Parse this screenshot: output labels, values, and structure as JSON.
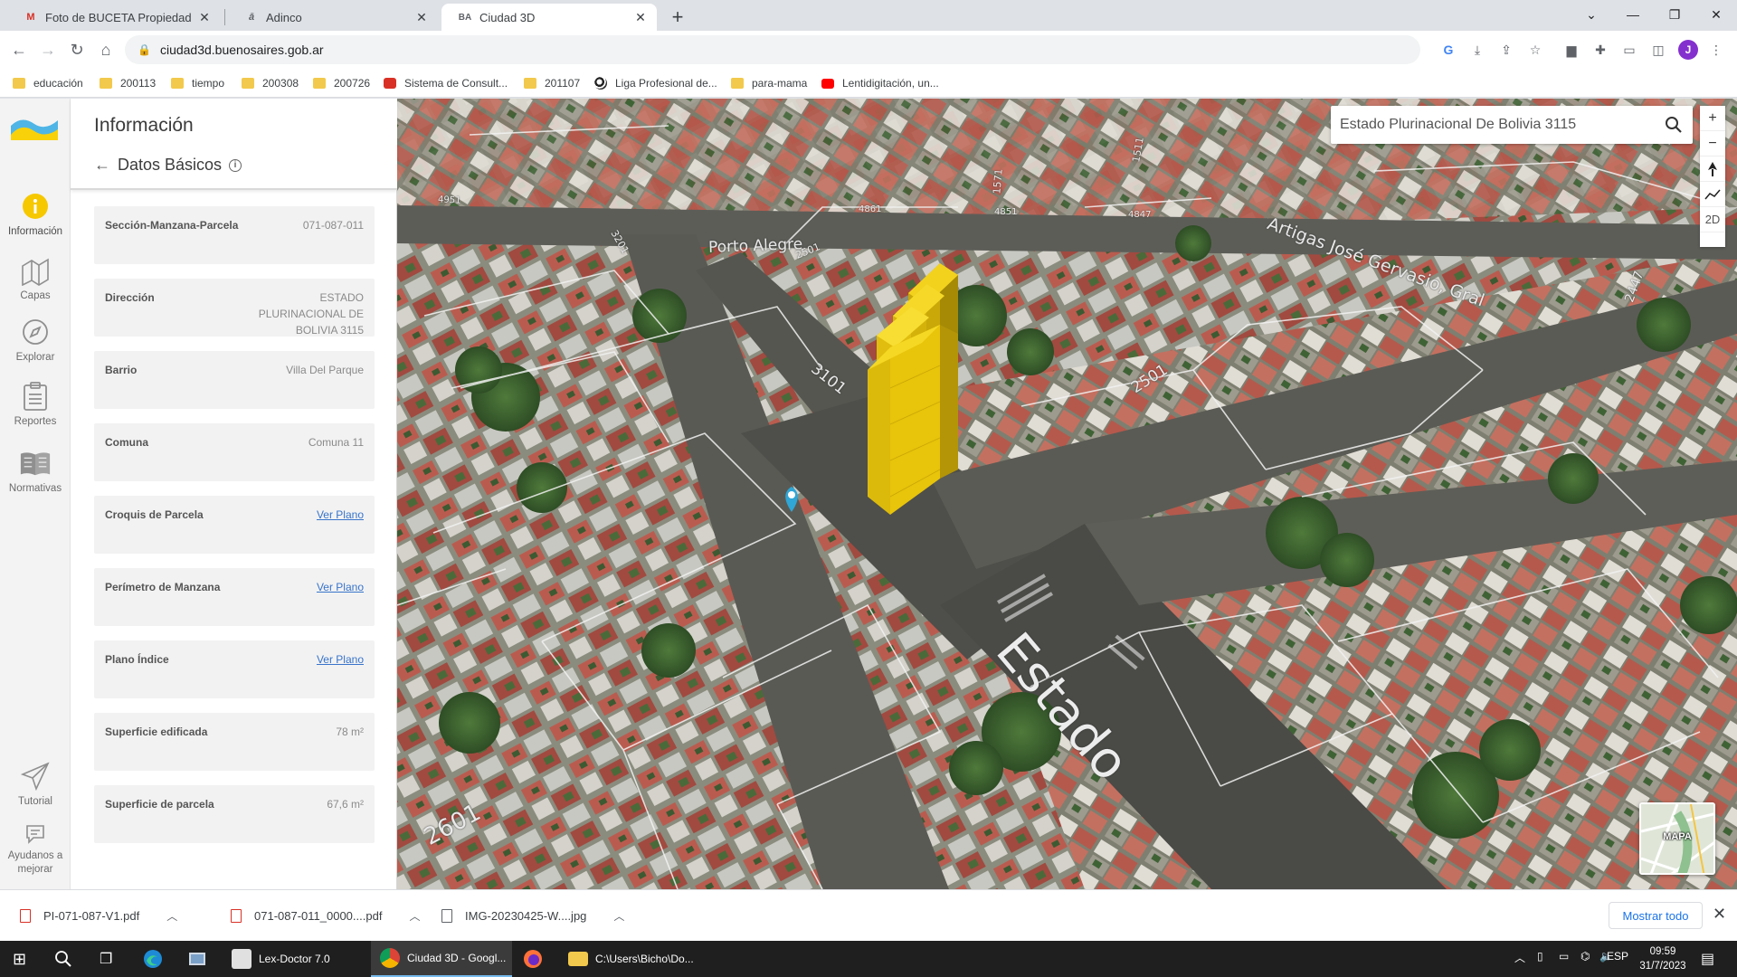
{
  "browser": {
    "tabs": [
      {
        "title": "Foto de BUCETA Propiedades - ju",
        "favicon": "gmail-icon",
        "active": false
      },
      {
        "title": "Adinco",
        "favicon": "adinco-icon",
        "active": false
      },
      {
        "title": "Ciudad 3D",
        "favicon": "ba-icon",
        "active": true
      }
    ],
    "url": "ciudad3d.buenosaires.gob.ar",
    "profile_initial": "J",
    "bookmarks": [
      {
        "label": "educación",
        "icon": "folder-icon"
      },
      {
        "label": "200113",
        "icon": "folder-icon"
      },
      {
        "label": "tiempo",
        "icon": "folder-icon"
      },
      {
        "label": "200308",
        "icon": "folder-icon"
      },
      {
        "label": "200726",
        "icon": "folder-icon"
      },
      {
        "label": "Sistema de Consult...",
        "icon": "sistema-icon"
      },
      {
        "label": "201107",
        "icon": "folder-icon"
      },
      {
        "label": "Liga Profesional de...",
        "icon": "soccer-ball-icon"
      },
      {
        "label": "para-mama",
        "icon": "folder-icon"
      },
      {
        "label": "Lentidigitación, un...",
        "icon": "youtube-icon"
      }
    ]
  },
  "rail": {
    "items": [
      {
        "label": "Información",
        "icon": "info-icon",
        "active": true
      },
      {
        "label": "Capas",
        "icon": "layers-icon",
        "active": false
      },
      {
        "label": "Explorar",
        "icon": "compass-icon",
        "active": false
      },
      {
        "label": "Reportes",
        "icon": "clipboard-icon",
        "active": false
      },
      {
        "label": "Normativas",
        "icon": "book-icon",
        "active": false
      }
    ],
    "bottom": [
      {
        "label": "Tutorial",
        "icon": "paper-plane-icon"
      },
      {
        "label": "Ayudanos a mejorar",
        "icon": "feedback-icon"
      }
    ]
  },
  "panel": {
    "title": "Información",
    "subtitle": "Datos Básicos",
    "fields": [
      {
        "label": "Sección-Manzana-Parcela",
        "value": "071-087-011",
        "link": false
      },
      {
        "label": "Dirección",
        "value": "ESTADO PLURINACIONAL DE BOLIVIA 3115",
        "link": false
      },
      {
        "label": "Barrio",
        "value": "Villa Del Parque",
        "link": false
      },
      {
        "label": "Comuna",
        "value": "Comuna 11",
        "link": false
      },
      {
        "label": "Croquis de Parcela",
        "value": "Ver Plano",
        "link": true
      },
      {
        "label": "Perímetro de Manzana",
        "value": "Ver Plano",
        "link": true
      },
      {
        "label": "Plano Índice",
        "value": "Ver Plano",
        "link": true
      },
      {
        "label": "Superficie edificada",
        "value": "78 m²",
        "link": false
      },
      {
        "label": "Superficie de parcela",
        "value": "67,6 m²",
        "link": false
      }
    ]
  },
  "map": {
    "search_value": "Estado Plurinacional De Bolivia 3115",
    "tools": [
      "zoom-in-icon",
      "zoom-out-icon",
      "north-arrow-icon",
      "tilt-icon"
    ],
    "mode_label": "2D",
    "minimap_label": "MAPA",
    "street_labels": {
      "porto_alegre": "Porto Alegre",
      "artigas": "Artigas José Gervasio, Gral",
      "estado": "Estado",
      "n3101": "3101",
      "n2501": "2501",
      "n2601": "2601",
      "n4951": "4951",
      "n4861": "4861",
      "n4851": "4851",
      "n4847": "4847",
      "n3201": "3201",
      "n2501b": "2501",
      "n1571": "1571",
      "n1511": "1511",
      "n2447": "2447"
    },
    "colors": {
      "building": "#e8c40a",
      "marker": "#2fa6d6"
    }
  },
  "downloads": {
    "items": [
      {
        "name": "PI-071-087-V1.pdf",
        "type": "pdf"
      },
      {
        "name": "071-087-011_0000....pdf",
        "type": "pdf"
      },
      {
        "name": "IMG-20230425-W....jpg",
        "type": "image"
      }
    ],
    "show_all": "Mostrar todo"
  },
  "taskbar": {
    "apps": [
      {
        "label": "Lex-Doctor 7.0",
        "icon": "lex-doctor-icon",
        "active": false
      },
      {
        "label": "Ciudad 3D - Googl...",
        "icon": "chrome-icon",
        "active": true
      },
      {
        "label": "C:\\Users\\Bicho\\Do...",
        "icon": "folder-icon",
        "active": false
      }
    ],
    "language": "ESP",
    "time": "09:59",
    "date": "31/7/2023"
  }
}
